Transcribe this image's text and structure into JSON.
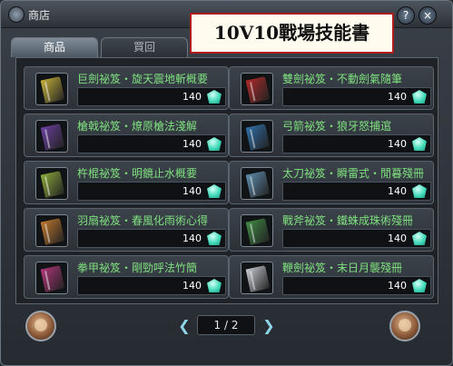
{
  "window": {
    "title": "商店",
    "help_label": "?",
    "close_label": "×"
  },
  "banner": "10V10戰場技能書",
  "tabs": [
    {
      "label": "商品",
      "active": true
    },
    {
      "label": "買回",
      "active": false
    }
  ],
  "items": [
    {
      "name": "巨劍祕笈・旋天震地斬概要",
      "price": "140",
      "book_color": "#c5b13a"
    },
    {
      "name": "雙劍祕笈・不動劍氣隨筆",
      "price": "140",
      "book_color": "#b02a2a"
    },
    {
      "name": "槍戟祕笈・燎原槍法淺解",
      "price": "140",
      "book_color": "#6a3fa0"
    },
    {
      "name": "弓箭祕笈・狼牙怒捕逭",
      "price": "140",
      "book_color": "#2f6fa8"
    },
    {
      "name": "杵棍祕笈・明鏡止水概要",
      "price": "140",
      "book_color": "#8bab3a"
    },
    {
      "name": "太刀祕笈・瞬雷式・閒暮殘冊",
      "price": "140",
      "book_color": "#5d8fb0"
    },
    {
      "name": "羽扇祕笈・春風化雨術心得",
      "price": "140",
      "book_color": "#c0782e"
    },
    {
      "name": "戰斧祕笈・鐵蛛成珠術殘冊",
      "price": "140",
      "book_color": "#3f8a45"
    },
    {
      "name": "拳甲祕笈・剛勁呼法竹簡",
      "price": "140",
      "book_color": "#b0357a"
    },
    {
      "name": "鞭劍祕笈・末日月襲殘冊",
      "price": "140",
      "book_color": "#c8ccd2"
    }
  ],
  "pager": {
    "label": "1 / 2",
    "current": 1,
    "total": 2
  },
  "icons": {
    "currency": "gem-icon",
    "prev": "prev-page-icon",
    "next": "next-page-icon"
  },
  "colors": {
    "item_name": "#7fe07f",
    "currency": "#3fd9b8",
    "banner_border": "#b01b1b"
  }
}
